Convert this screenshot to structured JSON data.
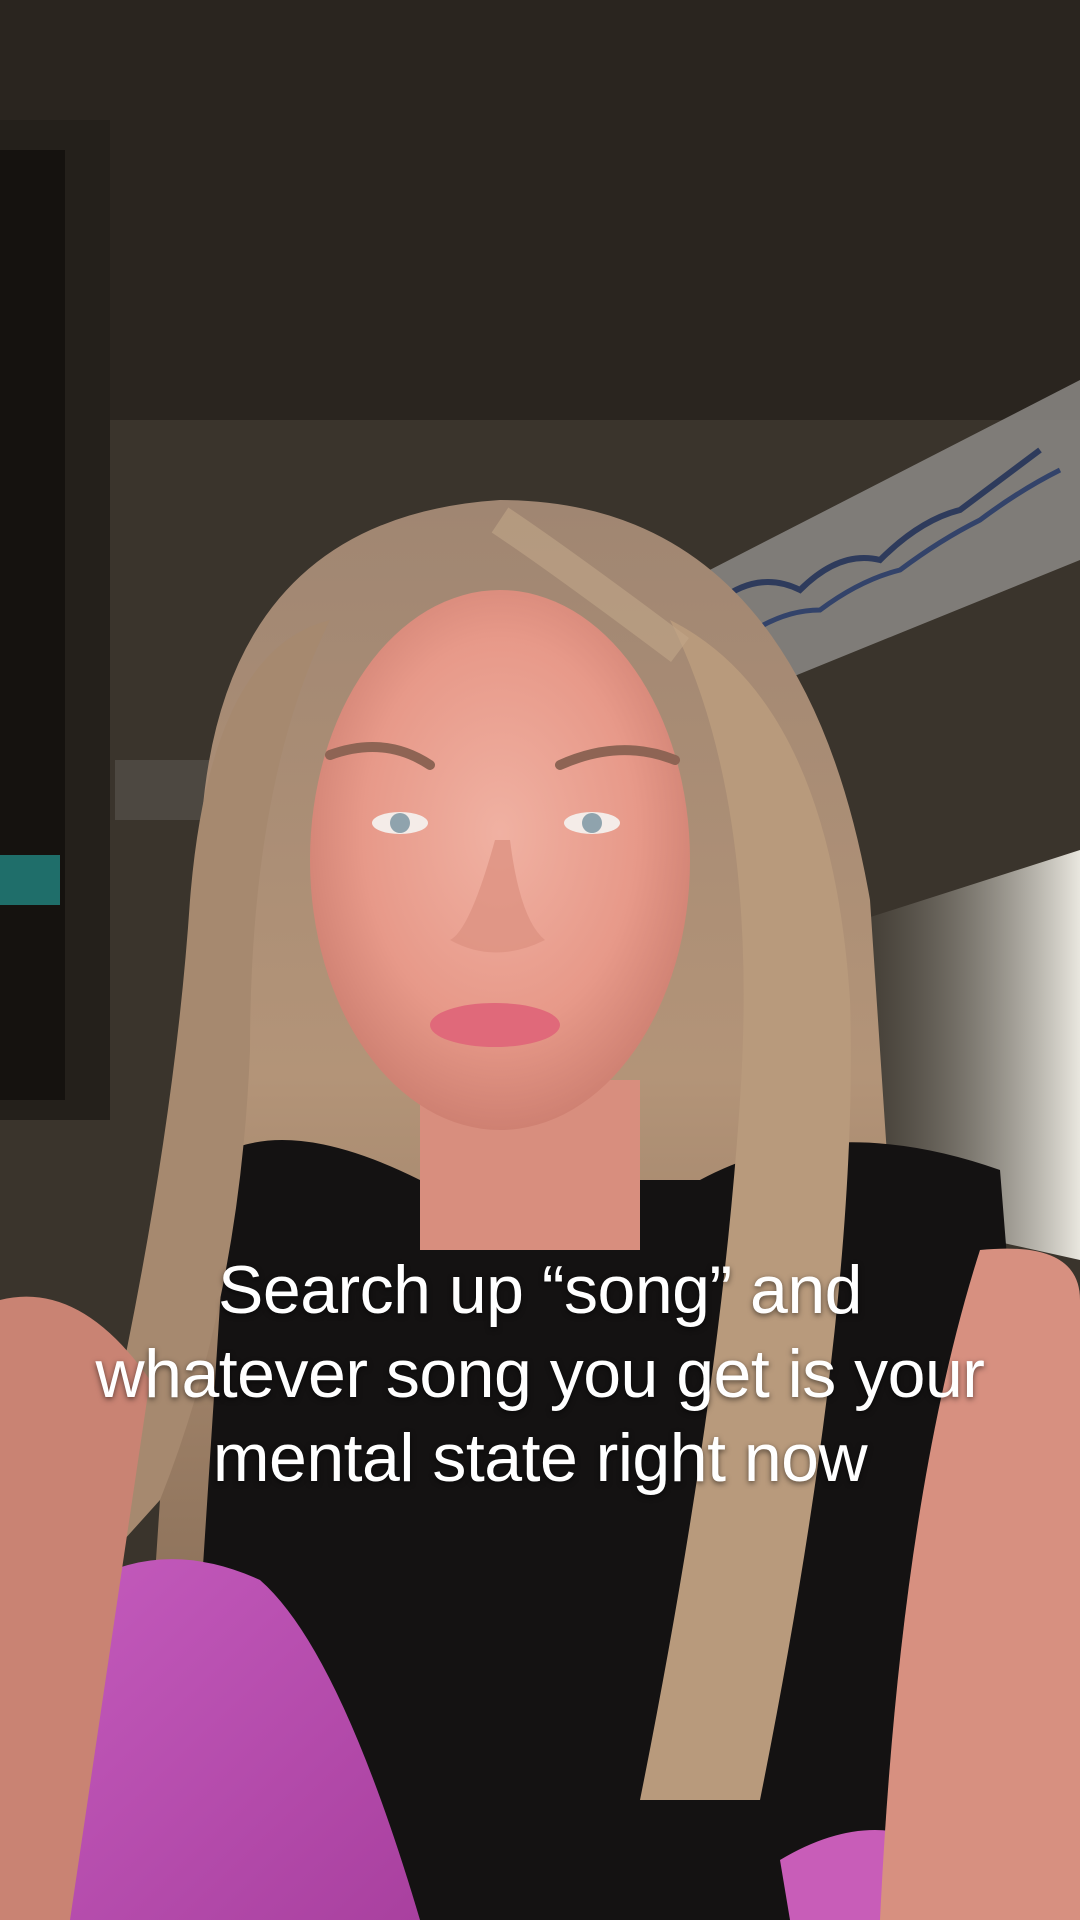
{
  "video": {
    "caption": "Search up “song” and whatever song you get is your mental state right now"
  }
}
